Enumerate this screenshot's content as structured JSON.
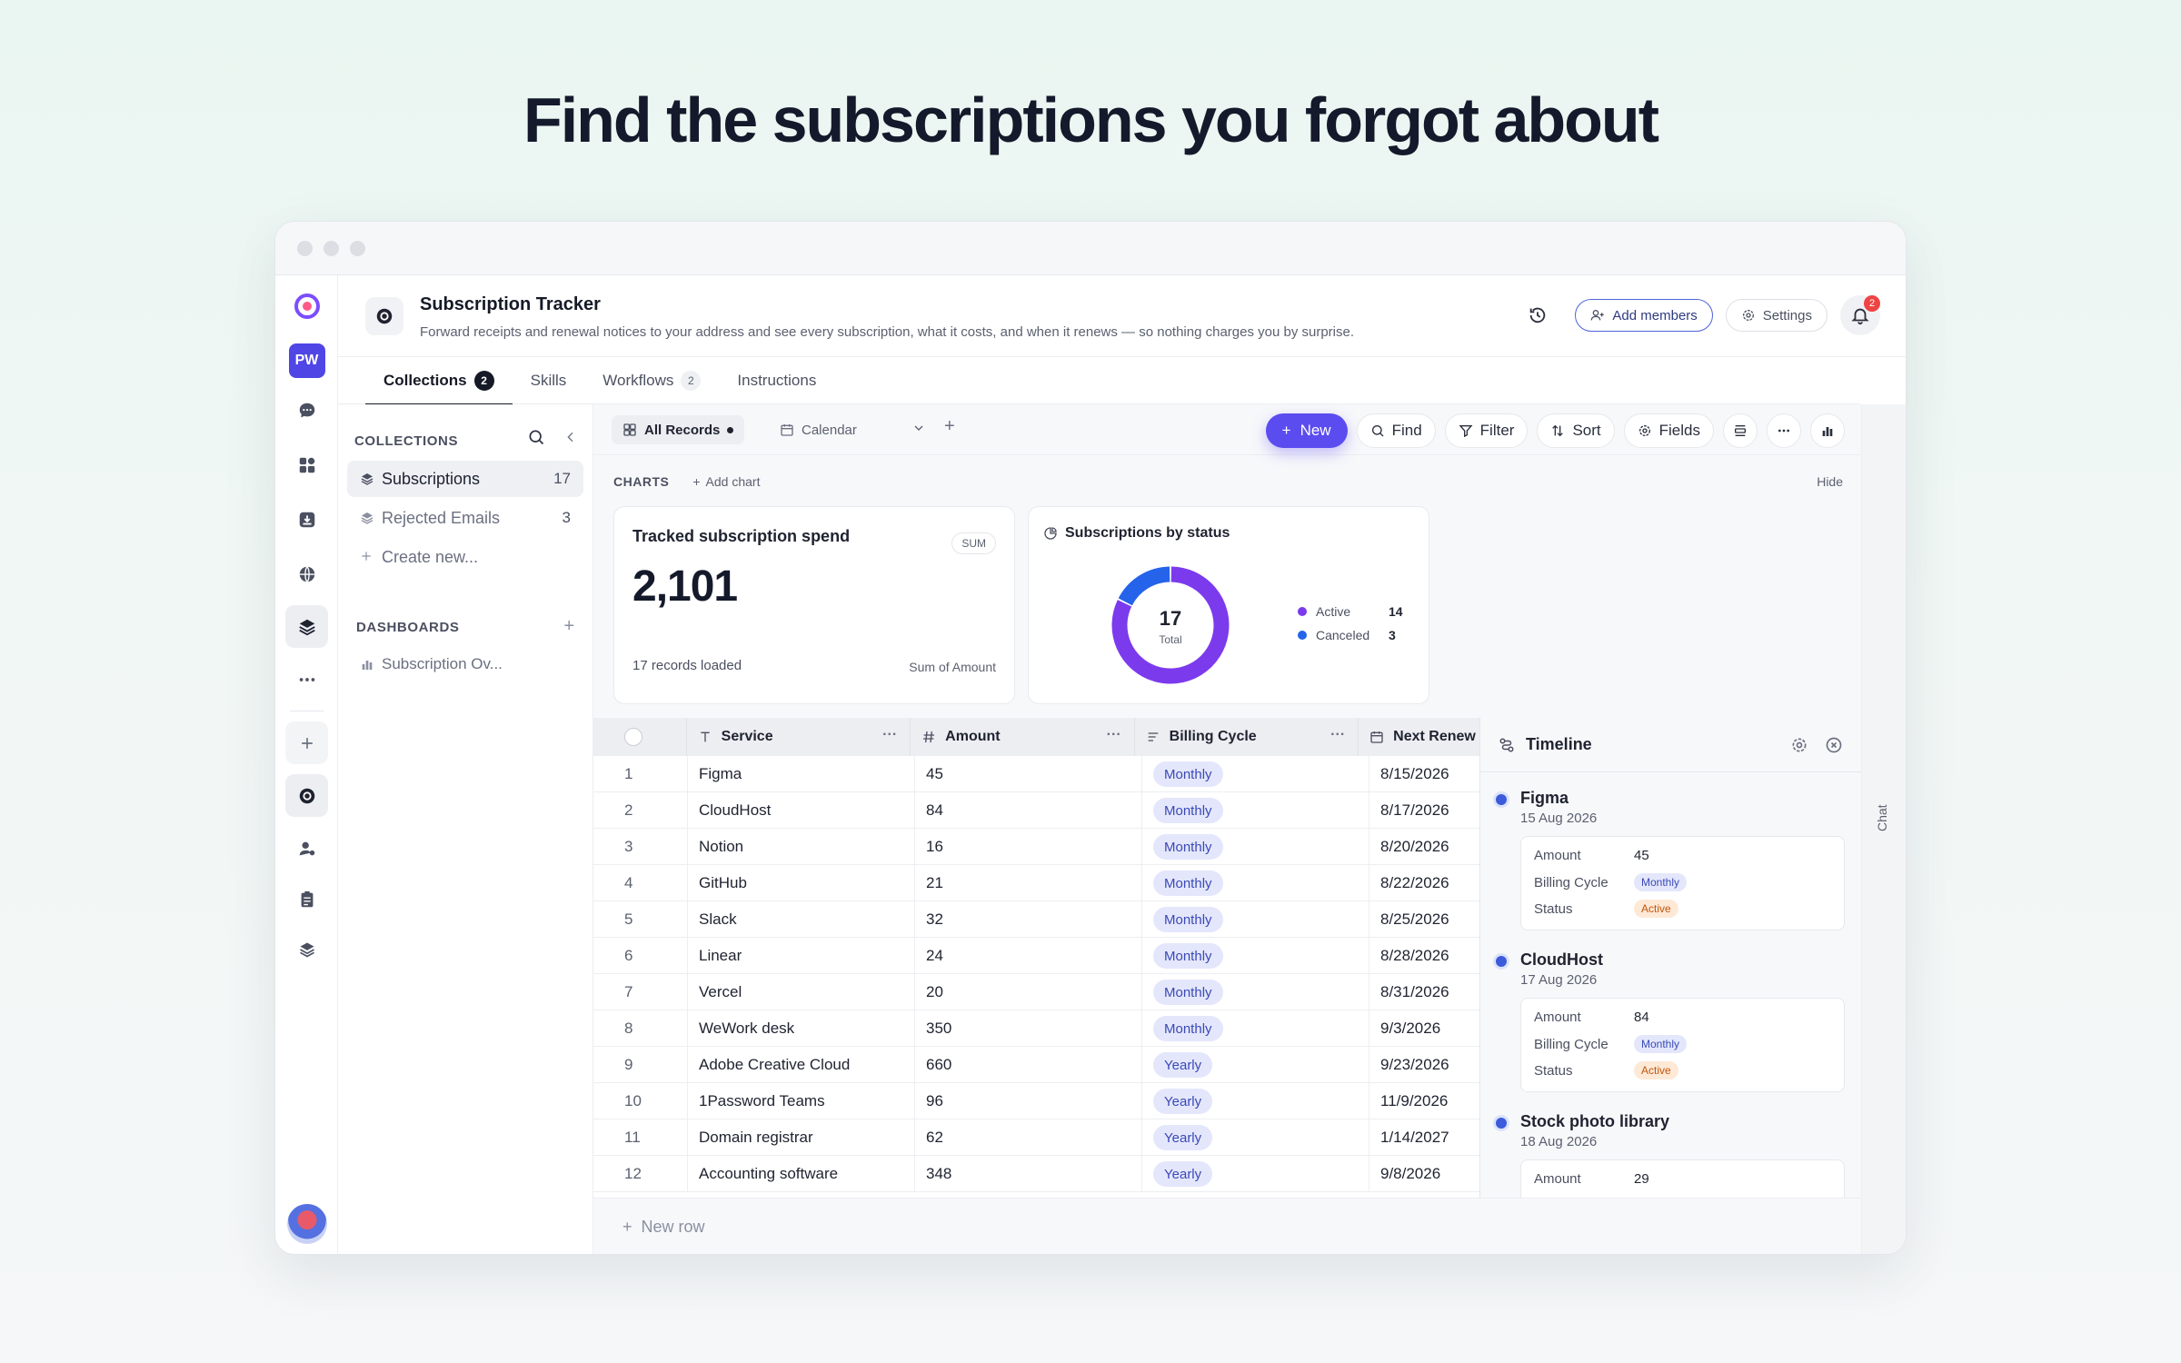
{
  "headline": "Find the subscriptions you forgot about",
  "rail": {
    "workspace_initials": "PW"
  },
  "header": {
    "title": "Subscription Tracker",
    "description": "Forward receipts and renewal notices to your address and see every subscription, what it costs, and when it renews — so nothing charges you by surprise.",
    "add_members": "Add members",
    "settings": "Settings",
    "notification_count": "2"
  },
  "tabs": [
    {
      "label": "Collections",
      "badge": "2"
    },
    {
      "label": "Skills"
    },
    {
      "label": "Workflows",
      "badge": "2"
    },
    {
      "label": "Instructions"
    }
  ],
  "sidebar": {
    "collections_heading": "COLLECTIONS",
    "items": [
      {
        "label": "Subscriptions",
        "count": "17"
      },
      {
        "label": "Rejected Emails",
        "count": "3"
      }
    ],
    "create_new": "Create new...",
    "dashboards_heading": "DASHBOARDS",
    "dashboards": [
      {
        "label": "Subscription Ov..."
      }
    ]
  },
  "toolbar": {
    "view_all": "All Records",
    "view_calendar": "Calendar",
    "new": "New",
    "find": "Find",
    "filter": "Filter",
    "sort": "Sort",
    "fields": "Fields"
  },
  "charts": {
    "label": "CHARTS",
    "add_chart": "Add chart",
    "hide": "Hide",
    "spend_card": {
      "title": "Tracked subscription spend",
      "badge": "SUM",
      "value": "2,101",
      "footer": "17 records loaded",
      "footer_right": "Sum of Amount"
    },
    "status_card": {
      "title": "Subscriptions by status",
      "total": "17",
      "total_label": "Total"
    }
  },
  "chart_data": {
    "type": "pie",
    "title": "Subscriptions by status",
    "categories": [
      "Active",
      "Canceled"
    ],
    "values": [
      14,
      3
    ],
    "colors": [
      "#7c3aed",
      "#2563eb"
    ],
    "center_value": 17,
    "center_label": "Total",
    "legend": "right"
  },
  "table": {
    "columns": [
      "Service",
      "Amount",
      "Billing Cycle",
      "Next Renew"
    ],
    "rows": [
      {
        "n": "1",
        "service": "Figma",
        "amount": "45",
        "cycle": "Monthly",
        "next": "8/15/2026"
      },
      {
        "n": "2",
        "service": "CloudHost",
        "amount": "84",
        "cycle": "Monthly",
        "next": "8/17/2026"
      },
      {
        "n": "3",
        "service": "Notion",
        "amount": "16",
        "cycle": "Monthly",
        "next": "8/20/2026"
      },
      {
        "n": "4",
        "service": "GitHub",
        "amount": "21",
        "cycle": "Monthly",
        "next": "8/22/2026"
      },
      {
        "n": "5",
        "service": "Slack",
        "amount": "32",
        "cycle": "Monthly",
        "next": "8/25/2026"
      },
      {
        "n": "6",
        "service": "Linear",
        "amount": "24",
        "cycle": "Monthly",
        "next": "8/28/2026"
      },
      {
        "n": "7",
        "service": "Vercel",
        "amount": "20",
        "cycle": "Monthly",
        "next": "8/31/2026"
      },
      {
        "n": "8",
        "service": "WeWork desk",
        "amount": "350",
        "cycle": "Monthly",
        "next": "9/3/2026"
      },
      {
        "n": "9",
        "service": "Adobe Creative Cloud",
        "amount": "660",
        "cycle": "Yearly",
        "next": "9/23/2026"
      },
      {
        "n": "10",
        "service": "1Password Teams",
        "amount": "96",
        "cycle": "Yearly",
        "next": "11/9/2026"
      },
      {
        "n": "11",
        "service": "Domain registrar",
        "amount": "62",
        "cycle": "Yearly",
        "next": "1/14/2027"
      },
      {
        "n": "12",
        "service": "Accounting software",
        "amount": "348",
        "cycle": "Yearly",
        "next": "9/8/2026"
      }
    ],
    "new_row": "New row"
  },
  "timeline": {
    "title": "Timeline",
    "field_labels": {
      "amount": "Amount",
      "cycle": "Billing Cycle",
      "status": "Status"
    },
    "entries": [
      {
        "name": "Figma",
        "date": "15 Aug 2026",
        "amount": "45",
        "cycle": "Monthly",
        "status": "Active"
      },
      {
        "name": "CloudHost",
        "date": "17 Aug 2026",
        "amount": "84",
        "cycle": "Monthly",
        "status": "Active"
      },
      {
        "name": "Stock photo library",
        "date": "18 Aug 2026",
        "amount": "29"
      }
    ]
  },
  "chat_label": "Chat"
}
